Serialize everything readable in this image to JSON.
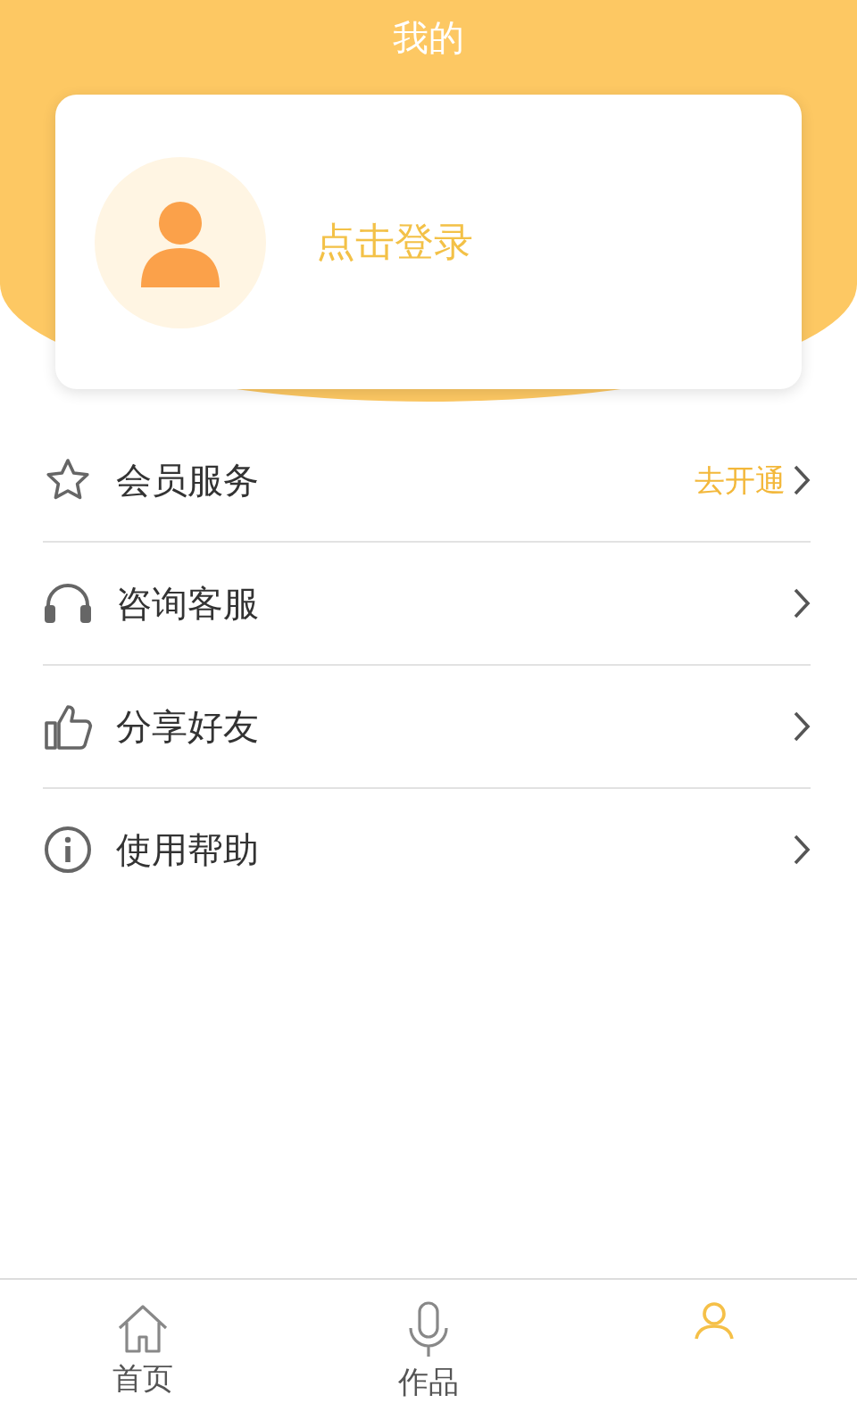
{
  "title": "我的",
  "login": {
    "label": "点击登录"
  },
  "menu": [
    {
      "kind": "star",
      "label": "会员服务",
      "action": "去开通"
    },
    {
      "kind": "headset",
      "label": "咨询客服"
    },
    {
      "kind": "thumb",
      "label": "分享好友"
    },
    {
      "kind": "info",
      "label": "使用帮助"
    }
  ],
  "tabs": [
    {
      "kind": "home",
      "label": "首页",
      "selected": false
    },
    {
      "kind": "mic",
      "label": "作品",
      "selected": false
    },
    {
      "kind": "person",
      "selected": true
    }
  ]
}
